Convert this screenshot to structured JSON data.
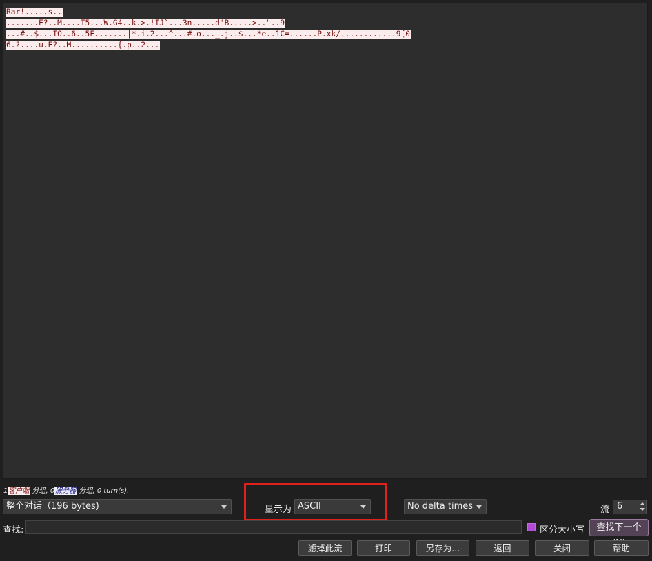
{
  "stream": {
    "lines": [
      "Rar!.....s..",
      ".......E?..M....T5...W.G4..k.>.!IJ`...3n.....d'B.....>..\"..9",
      "...#..$...IO..6..5F.......|*.i.2...^...#.o..._.j..$...*e..1C=......P.xk/............9[0",
      "6.?....u.E?..M..........{.p..2..."
    ]
  },
  "stats": {
    "client_count": "1",
    "client_label": "客户端",
    "client_suffix": " 分组, ",
    "server_count": "0",
    "server_label": "服务器",
    "server_suffix": " 分组, 0 turn(s)."
  },
  "controls": {
    "conversation_select": "整个对话（196 bytes)",
    "show_as_label": "显示为",
    "show_as_value": "ASCII",
    "delta_select": "No delta times",
    "stream_label": "流",
    "stream_value": "6"
  },
  "search": {
    "label": "查找:",
    "value": "",
    "case_label": "区分大小写",
    "find_next": "查找下一个(N)"
  },
  "buttons": {
    "filter_out": "滤掉此流",
    "print": "打印",
    "save_as": "另存为...",
    "back": "返回",
    "close": "关闭",
    "help": "帮助"
  },
  "colors": {
    "client_bg": "#fbeded",
    "client_fg": "#7a0f0f",
    "server_bg": "#ededfb",
    "server_fg": "#0f0f7a",
    "highlight": "#e0201a",
    "checkbox": "#b04bd6"
  }
}
